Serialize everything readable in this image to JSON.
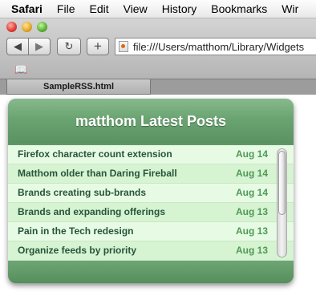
{
  "menubar": {
    "app": "Safari",
    "items": [
      "File",
      "Edit",
      "View",
      "History",
      "Bookmarks",
      "Wir"
    ]
  },
  "toolbar": {
    "back_icon": "◀",
    "forward_icon": "▶",
    "reload_icon": "↻",
    "add_icon": "+",
    "address": "file:///Users/matthom/Library/Widgets",
    "bookmarks_icon": "📖"
  },
  "tab": {
    "title": "SampleRSS.html"
  },
  "widget": {
    "title": "matthom Latest Posts",
    "posts": [
      {
        "title": "Firefox character count extension",
        "date": "Aug 14"
      },
      {
        "title": "Matthom older than Daring Fireball",
        "date": "Aug 14"
      },
      {
        "title": "Brands creating sub-brands",
        "date": "Aug 14"
      },
      {
        "title": "Brands and expanding offerings",
        "date": "Aug 13"
      },
      {
        "title": "Pain in the Tech redesign",
        "date": "Aug 13"
      },
      {
        "title": "Organize feeds by priority",
        "date": "Aug 13"
      }
    ]
  },
  "colors": {
    "widget_header": "#6aa471",
    "row_bg": "#dff8dc",
    "title_text": "#27553a",
    "date_text": "#4e9a55"
  }
}
